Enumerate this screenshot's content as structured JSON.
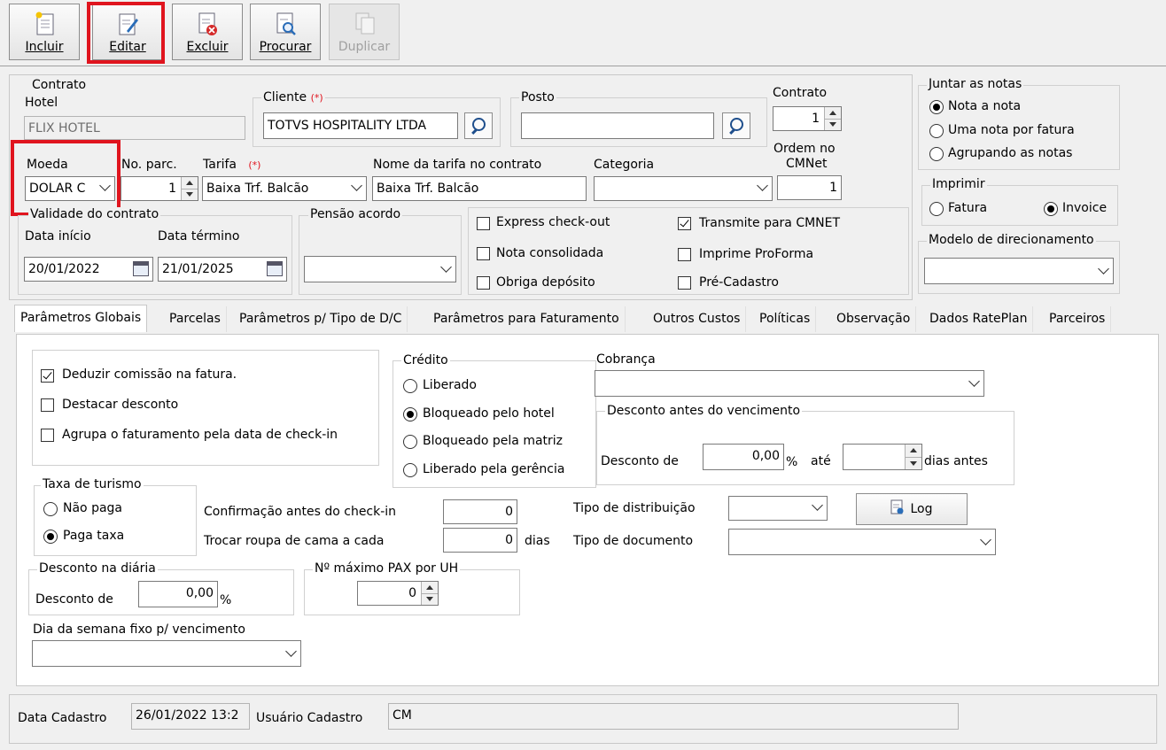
{
  "toolbar": {
    "buttons": [
      {
        "label": "Incluir"
      },
      {
        "label": "Editar"
      },
      {
        "label": "Excluir"
      },
      {
        "label": "Procurar"
      },
      {
        "label": "Duplicar"
      }
    ]
  },
  "header": {
    "contrato_group": "Contrato",
    "hotel_label": "Hotel",
    "hotel_value": "FLIX HOTEL",
    "cliente_label": "Cliente",
    "required_mark": "(*)",
    "cliente_value": "TOTVS HOSPITALITY LTDA",
    "posto_label": "Posto",
    "posto_value": "",
    "contrato_label": "Contrato",
    "contrato_value": "1",
    "moeda_label": "Moeda",
    "moeda_value": "DOLAR C",
    "noparc_label": "No. parc.",
    "noparc_value": "1",
    "tarifa_label": "Tarifa",
    "tarifa_value": "Baixa Trf. Balcão",
    "nome_tarifa_label": "Nome da tarifa no contrato",
    "nome_tarifa_value": "Baixa Trf. Balcão",
    "categoria_label": "Categoria",
    "categoria_value": "",
    "ordem_label_1": "Ordem no",
    "ordem_label_2": "CMNet",
    "ordem_value": "1",
    "validade_label": "Validade do contrato",
    "data_inicio_label": "Data início",
    "data_inicio_value": "20/01/2022",
    "data_termino_label": "Data término",
    "data_termino_value": "21/01/2025",
    "pensao_label": "Pensão acordo",
    "pensao_value": "",
    "flags": {
      "express": "Express check-out",
      "nota_consolidada": "Nota consolidada",
      "obriga_deposito": "Obriga depósito",
      "transmite": "Transmite para CMNET",
      "imprime_proforma": "Imprime ProForma",
      "pre_cadastro": "Pré-Cadastro"
    }
  },
  "right": {
    "juntar_label": "Juntar as notas",
    "juntar_options": [
      "Nota a nota",
      "Uma nota por fatura",
      "Agrupando as notas"
    ],
    "imprimir_label": "Imprimir",
    "imprimir_fatura": "Fatura",
    "imprimir_invoice": "Invoice",
    "modelo_label": "Modelo de direcionamento",
    "modelo_value": ""
  },
  "tabs": [
    "Parâmetros Globais",
    "Parcelas",
    "Parâmetros p/ Tipo de D/C",
    "Parâmetros para Faturamento",
    "Outros Custos",
    "Políticas",
    "Observação",
    "Dados RatePlan",
    "Parceiros"
  ],
  "globais": {
    "deduzir": "Deduzir comissão na fatura.",
    "destacar": "Destacar desconto",
    "agrupa": "Agrupa o faturamento pela data de check-in",
    "credito_label": "Crédito",
    "credito_options": [
      "Liberado",
      "Bloqueado pelo hotel",
      "Bloqueado pela matriz",
      "Liberado pela gerência"
    ],
    "cobranca_label": "Cobrança",
    "cobranca_value": "",
    "desc_venc_label": "Desconto antes do vencimento",
    "desconto_de": "Desconto de",
    "desc_venc_value": "0,00",
    "percent": "%",
    "ate": "até",
    "dias_antes": "dias antes",
    "taxa_label": "Taxa de turismo",
    "nao_paga": "Não paga",
    "paga_taxa": "Paga taxa",
    "confirmacao_label": "Confirmação antes do check-in",
    "confirmacao_value": "0",
    "trocar_label": "Trocar roupa de cama a cada",
    "trocar_value": "0",
    "dias": "dias",
    "tipo_distrib_label": "Tipo de distribuição",
    "tipo_distrib_value": "",
    "tipo_doc_label": "Tipo de documento",
    "tipo_doc_value": "",
    "log_label": "Log",
    "desc_diaria_label": "Desconto na diária",
    "desc_diaria_value": "0,00",
    "pax_label": "Nº máximo PAX por UH",
    "pax_value": "0",
    "dia_semana_label": "Dia da semana fixo p/ vencimento",
    "dia_semana_value": ""
  },
  "footer": {
    "data_cadastro_label": "Data Cadastro",
    "data_cadastro_value": "26/01/2022 13:2",
    "usuario_label": "Usuário Cadastro",
    "usuario_value": "CM"
  }
}
